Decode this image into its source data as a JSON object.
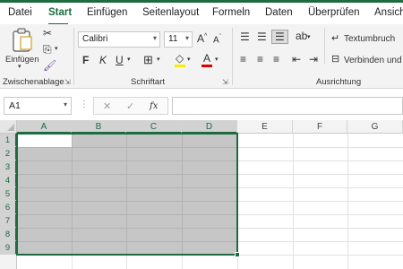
{
  "tabs": [
    {
      "label": "Datei",
      "active": false
    },
    {
      "label": "Start",
      "active": true
    },
    {
      "label": "Einfügen",
      "active": false
    },
    {
      "label": "Seitenlayout",
      "active": false
    },
    {
      "label": "Formeln",
      "active": false
    },
    {
      "label": "Daten",
      "active": false
    },
    {
      "label": "Überprüfen",
      "active": false
    },
    {
      "label": "Ansicht",
      "active": false
    }
  ],
  "ribbon": {
    "clipboard": {
      "paste_label": "Einfügen",
      "group_label": "Zwischenablage"
    },
    "font": {
      "family": "Calibri",
      "size": "11",
      "bold": "F",
      "italic": "K",
      "underline": "U",
      "group_label": "Schriftart"
    },
    "alignment": {
      "wrap_label": "Textumbruch",
      "merge_label": "Verbinden und z",
      "group_label": "Ausrichtung"
    }
  },
  "formula_bar": {
    "name_box": "A1",
    "formula": ""
  },
  "grid": {
    "columns": [
      "A",
      "B",
      "C",
      "D",
      "E",
      "F",
      "G"
    ],
    "rows": [
      "1",
      "2",
      "3",
      "4",
      "5",
      "6",
      "7",
      "8",
      "9"
    ],
    "selection": "A1:D9",
    "active_cell": "A1"
  },
  "colors": {
    "accent": "#1d6b41",
    "selection_fill": "#c6c6c6",
    "ribbon_bg": "#f3f3f3"
  }
}
